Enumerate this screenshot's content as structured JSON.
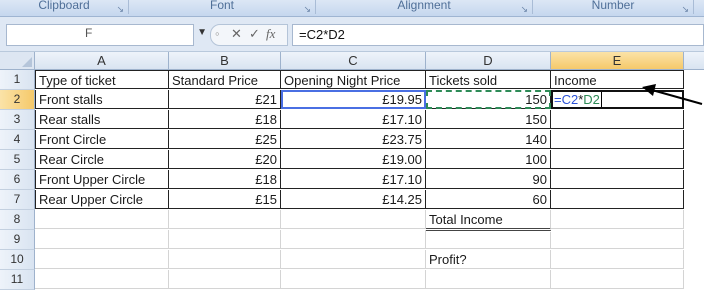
{
  "ribbon": {
    "groups": [
      "Clipboard",
      "Font",
      "Alignment",
      "Number"
    ]
  },
  "formula_bar": {
    "name_box": "F",
    "cancel_icon": "✕",
    "enter_icon": "✓",
    "fx_label": "fx",
    "formula": "=C2*D2"
  },
  "columns": [
    "A",
    "B",
    "C",
    "D",
    "E"
  ],
  "rows": [
    "1",
    "2",
    "3",
    "4",
    "5",
    "6",
    "7",
    "8",
    "9",
    "10",
    "11"
  ],
  "headers": {
    "a": "Type of ticket",
    "b": "Standard Price",
    "c": "Opening Night Price",
    "d": "Tickets sold",
    "e": "Income"
  },
  "data_rows": [
    {
      "type": "Front stalls",
      "standard": "£21",
      "opening": "£19.95",
      "sold": "150"
    },
    {
      "type": "Rear stalls",
      "standard": "£18",
      "opening": "£17.10",
      "sold": "150"
    },
    {
      "type": "Front Circle",
      "standard": "£25",
      "opening": "£23.75",
      "sold": "140"
    },
    {
      "type": "Rear Circle",
      "standard": "£20",
      "opening": "£19.00",
      "sold": "100"
    },
    {
      "type": "Front Upper Circle",
      "standard": "£18",
      "opening": "£17.10",
      "sold": "90"
    },
    {
      "type": "Rear Upper Circle",
      "standard": "£15",
      "opening": "£14.25",
      "sold": "60"
    }
  ],
  "editing_cell": {
    "part1": "=C2",
    "op": "*",
    "part2": "D2"
  },
  "labels": {
    "total_income": "Total Income",
    "profit": "Profit?"
  },
  "colors": {
    "ref_c": "#4a6fe3",
    "ref_d": "#2e8b57",
    "selected_header": "#f5c96a"
  }
}
